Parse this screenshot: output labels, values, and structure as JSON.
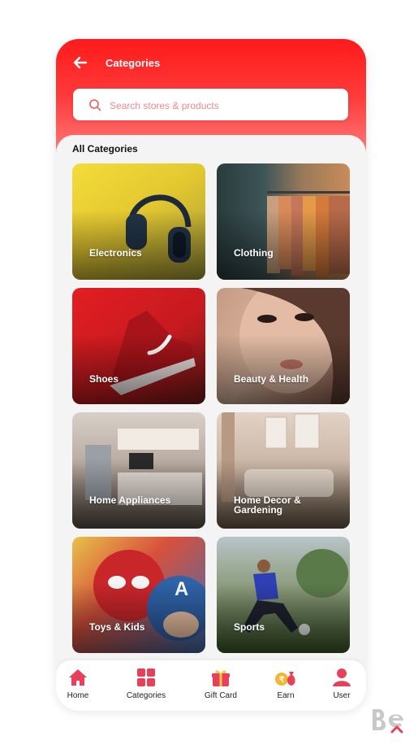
{
  "header": {
    "title": "Categories",
    "back_icon": "arrow-left-icon",
    "search_placeholder": "Search stores & products",
    "search_icon": "search-icon"
  },
  "section_title": "All Categories",
  "categories": [
    {
      "label": "Electronics",
      "image": "headphones"
    },
    {
      "label": "Clothing",
      "image": "clothes-rack"
    },
    {
      "label": "Shoes",
      "image": "red-sneaker"
    },
    {
      "label": "Beauty & Health",
      "image": "makeup-face"
    },
    {
      "label": "Home Appliances",
      "image": "kitchen"
    },
    {
      "label": "Home Decor & Gardening",
      "image": "living-room"
    },
    {
      "label": "Toys & Kids",
      "image": "kids-superheroes"
    },
    {
      "label": "Sports",
      "image": "football-player"
    }
  ],
  "bottom_nav": [
    {
      "label": "Home",
      "icon": "home-icon"
    },
    {
      "label": "Categories",
      "icon": "grid-icon"
    },
    {
      "label": "Gift Card",
      "icon": "gift-icon"
    },
    {
      "label": "Earn",
      "icon": "coin-bag-icon"
    },
    {
      "label": "User",
      "icon": "user-icon"
    }
  ],
  "colors": {
    "accent": "#ff1a1a",
    "nav_icon": "#e8405a"
  }
}
